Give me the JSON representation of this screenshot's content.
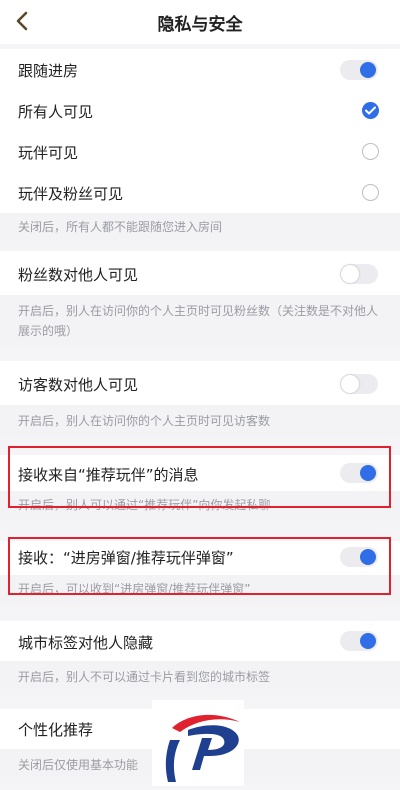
{
  "header": {
    "title": "隐私与安全"
  },
  "follow": {
    "label": "跟随进房",
    "options": [
      "所有人可见",
      "玩伴可见",
      "玩伴及粉丝可见"
    ],
    "desc": "关闭后，所有人都不能跟随您进入房间"
  },
  "fans": {
    "label": "粉丝数对他人可见",
    "desc": "开启后，别人在访问你的个人主页时可见粉丝数（关注数是不对他人展示的哦）"
  },
  "visitors": {
    "label": "访客数对他人可见",
    "desc": "开启后，别人在访问你的个人主页时可见访客数"
  },
  "recommend_msg": {
    "label": "接收来自“推荐玩伴”的消息",
    "desc": "开启后，别人可以通过“推荐玩伴”向你发起私聊"
  },
  "popup": {
    "label": "接收：“进房弹窗/推荐玩伴弹窗”",
    "desc": "开启后，可以收到“进房弹窗/推荐玩伴弹窗”"
  },
  "city": {
    "label": "城市标签对他人隐藏",
    "desc": "开启后，别人不可以通过卡片看到您的城市标签"
  },
  "personal": {
    "label": "个性化推荐",
    "desc": "关闭后仅使用基本功能"
  },
  "colors": {
    "accent": "#2f6ee6",
    "highlight": "#e0212e"
  }
}
